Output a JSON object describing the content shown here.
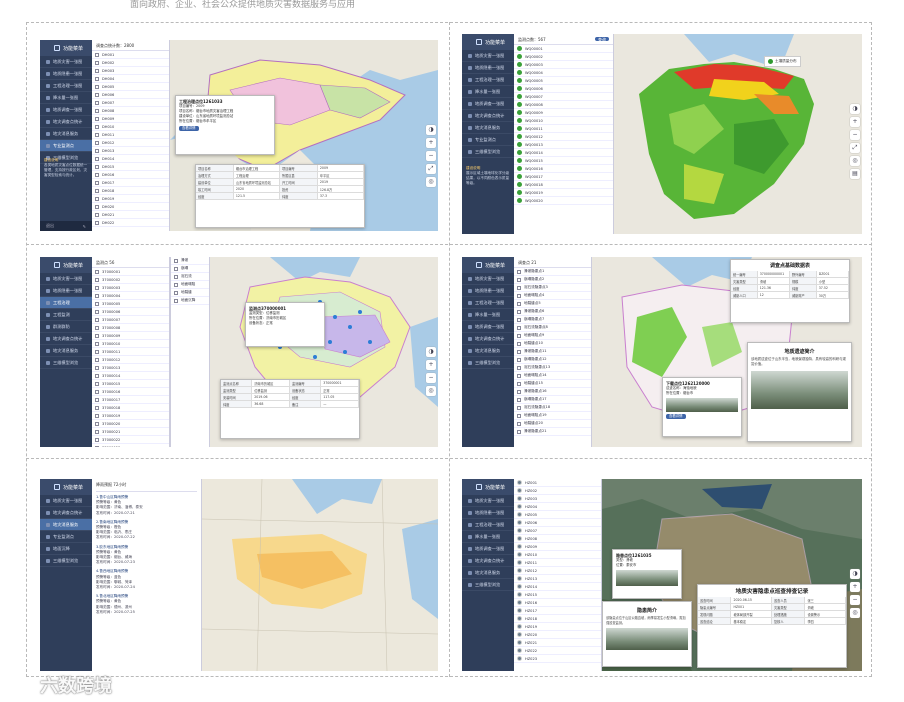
{
  "top_text": "面向政府、企业、社会公众提供地质灾害数据服务与应用",
  "menu_title": "功能菜单",
  "watermark": "六数跨境",
  "panel1": {
    "sidebar": [
      "地质灾害一张图",
      "地质隐患一张图",
      "工程治理一张图",
      "降水量一张图",
      "地质调查一张图",
      "地灾调查点统计",
      "地灾消息服务",
      "专业监测点",
      "三维模型浏览"
    ],
    "list_head": "调查点统计数：2800",
    "list_items": [
      "DH001",
      "DH002",
      "DH003",
      "DH004",
      "DH005",
      "DH006",
      "DH007",
      "DH008",
      "DH009",
      "DH010",
      "DH011",
      "DH012",
      "DH013",
      "DH014",
      "DH015",
      "DH016",
      "DH017",
      "DH018",
      "DH019",
      "DH020",
      "DH021",
      "DH022"
    ],
    "popup_title": "工程治理点位1261033",
    "popup_lines": [
      "项目编号：2009",
      "项目名称：烟台市地质灾害治理工程",
      "建设单位：山东省地质环境监测总站",
      "所在位置：烟台市牟平区"
    ],
    "popup_btn": "查看详情",
    "table_rows": [
      [
        "项目名称",
        "烟台市治理工程",
        "项目编号",
        "2009"
      ],
      [
        "治理方式",
        "工程治理",
        "所属区县",
        "牟平区"
      ],
      [
        "建设单位",
        "山东省地质环境监测总站",
        "开工时间",
        "2019"
      ],
      [
        "竣工时间",
        "2020",
        "投资",
        "126.8万"
      ],
      [
        "经度",
        "121.5",
        "纬度",
        "37.3"
      ]
    ],
    "note_title": "建设说明",
    "note": "各类地质灾害点位数据统一管理，支持按行政区划、灾害类型检索与统计。",
    "foot": "退出"
  },
  "panel2": {
    "sidebar": [
      "地质灾害一张图",
      "地质隐患一张图",
      "工程治理一张图",
      "降水量一张图",
      "地质调查一张图",
      "地灾调查点统计",
      "地灾消息服务",
      "专业监测点",
      "三维模型浏览"
    ],
    "list_head": "监测点数：567",
    "list_btn": "查询",
    "list_items": [
      "WQ00001",
      "WQ00002",
      "WQ00003",
      "WQ00004",
      "WQ00005",
      "WQ00006",
      "WQ00007",
      "WQ00008",
      "WQ00009",
      "WQ00010",
      "WQ00011",
      "WQ00012",
      "WQ00013",
      "WQ00014",
      "WQ00015",
      "WQ00016",
      "WQ00017",
      "WQ00018",
      "WQ00019",
      "WQ00020"
    ],
    "legend": "土壤质量分布",
    "note_title": "建设说明",
    "note": "展示区域土壤地球化学分级结果，以不同颜色表示质量等级。"
  },
  "panel3": {
    "sidebar": [
      "地质灾害一张图",
      "地质隐患一张图",
      "工程治理",
      "工程监测",
      "群测群防",
      "地灾调查点统计",
      "地灾消息服务",
      "三维模型浏览"
    ],
    "list_head": "监测点 56",
    "list_items": [
      "37000001",
      "37000002",
      "37000003",
      "37000004",
      "37000005",
      "37000006",
      "37000007",
      "37000008",
      "37000009",
      "37000010",
      "37000011",
      "37000012",
      "37000013",
      "37000014",
      "37000015",
      "37000016",
      "37000017",
      "37000018",
      "37000019",
      "37000020",
      "37000021",
      "37000022",
      "37000023"
    ],
    "filters": [
      "滑坡",
      "崩塌",
      "泥石流",
      "地面塌陷",
      "地裂缝",
      "地面沉降"
    ],
    "popup_title": "监测点370000001",
    "popup_lines": [
      "监测类型：位移监测",
      "所在位置：济南市历城区",
      "设备状态：正常"
    ],
    "table_rows": [
      [
        "监测点名称",
        "济南市历城区",
        "监测编号",
        "370000001"
      ],
      [
        "监测类型",
        "位移监测",
        "设备状态",
        "正常"
      ],
      [
        "安装时间",
        "2019-06",
        "经度",
        "117.05"
      ],
      [
        "纬度",
        "36.68",
        "备注",
        "—"
      ]
    ]
  },
  "panel4": {
    "sidebar": [
      "地质灾害一张图",
      "地质隐患一张图",
      "工程治理一张图",
      "降水量一张图",
      "地质调查一张图",
      "地灾调查点统计",
      "地灾消息服务",
      "三维模型浏览"
    ],
    "list_head": "调查点 21",
    "list_items": [
      "滑坡隐患点1",
      "崩塌隐患点2",
      "泥石流隐患点3",
      "地面塌陷点4",
      "地裂缝点5",
      "滑坡隐患点6",
      "崩塌隐患点7",
      "泥石流隐患点8",
      "地面塌陷点9",
      "地裂缝点10",
      "滑坡隐患点11",
      "崩塌隐患点12",
      "泥石流隐患点13",
      "地面塌陷点14",
      "地裂缝点15",
      "滑坡隐患点16",
      "崩塌隐患点17",
      "泥石流隐患点18",
      "地面塌陷点19",
      "地裂缝点20",
      "滑坡隐患点21"
    ],
    "report_title": "调查点基础数据表",
    "report_rows": [
      [
        "统一编号",
        "370000000001",
        "野外编号",
        "DZ001"
      ],
      [
        "灾害类型",
        "滑坡",
        "规模",
        "小型"
      ],
      [
        "经度",
        "121.36",
        "纬度",
        "37.52"
      ],
      [
        "威胁人口",
        "12",
        "威胁财产",
        "30万"
      ]
    ],
    "intro_title": "地质遗迹简介",
    "intro_text": "该地质遗迹位于山东半岛，地貌景观独特，具有较高的科研与观赏价值。",
    "popup_title": "下载点位1262120000",
    "popup_lines": [
      "遗迹名称：海蚀地貌",
      "所在位置：烟台市"
    ],
    "popup_btn": "查看详情"
  },
  "panel5": {
    "sidebar": [
      "地质灾害一张图",
      "地灾调查点统计",
      "地灾消息服务",
      "专业监测点",
      "地面沉降",
      "三维模型浏览"
    ],
    "list_head": "降雨预报 72小时",
    "entries": [
      {
        "title": "1.鲁中山区降雨预警",
        "l1": "预警等级：黄色",
        "l2": "影响范围：济南、淄博、泰安",
        "l3": "发布时间：2020-07-21"
      },
      {
        "title": "2.鲁南地区降雨预警",
        "l1": "预警等级：橙色",
        "l2": "影响范围：临沂、枣庄",
        "l3": "发布时间：2020-07-22"
      },
      {
        "title": "3.胶东地区降雨预警",
        "l1": "预警等级：黄色",
        "l2": "影响范围：烟台、威海",
        "l3": "发布时间：2020-07-23"
      },
      {
        "title": "4.鲁西地区降雨预警",
        "l1": "预警等级：蓝色",
        "l2": "影响范围：聊城、菏泽",
        "l3": "发布时间：2020-07-24"
      },
      {
        "title": "5.鲁北地区降雨预警",
        "l1": "预警等级：黄色",
        "l2": "影响范围：德州、滨州",
        "l3": "发布时间：2020-07-25"
      }
    ]
  },
  "panel6": {
    "sidebar": [
      "地质灾害一张图",
      "地质隐患一张图",
      "工程治理一张图",
      "降水量一张图",
      "地质调查一张图",
      "地灾调查点统计",
      "地灾消息服务",
      "三维模型浏览"
    ],
    "list_items": [
      "HZ001",
      "HZ002",
      "HZ003",
      "HZ004",
      "HZ005",
      "HZ006",
      "HZ007",
      "HZ008",
      "HZ009",
      "HZ010",
      "HZ011",
      "HZ012",
      "HZ013",
      "HZ014",
      "HZ015",
      "HZ016",
      "HZ017",
      "HZ018",
      "HZ019",
      "HZ020",
      "HZ021",
      "HZ022",
      "HZ023"
    ],
    "report_title": "地质灾害隐患点巡查排查记录",
    "report_rows": [
      [
        "巡查时间",
        "2020-06-15",
        "巡查人员",
        "张三"
      ],
      [
        "隐患点编号",
        "HZ001",
        "灾害类型",
        "滑坡"
      ],
      [
        "发现问题",
        "坡体局部开裂",
        "处理措施",
        "设置警示"
      ],
      [
        "巡查结论",
        "基本稳定",
        "复核人",
        "李四"
      ]
    ],
    "intro_title": "隐患简介",
    "intro_text": "该隐患点位于山区公路边坡，雨季易发生小型滑塌，需加强巡查监测。",
    "popup_title": "隐患点位1261035",
    "popup_lines": [
      "类型：滑坡",
      "位置：泰安市"
    ]
  }
}
